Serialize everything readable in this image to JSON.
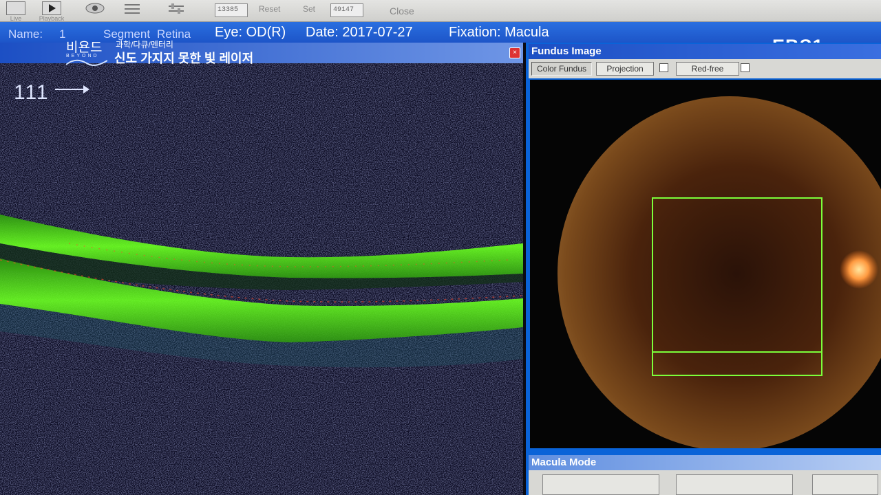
{
  "toolbar": {
    "live_label": "Live",
    "playback_label": "Playback",
    "frame_value": "13385",
    "reset_label": "Reset",
    "set_label": "Set",
    "set_value": "49147",
    "close_label": "Close"
  },
  "infobar": {
    "name_label": "Name:",
    "name_value": "1",
    "segment_value": "Segment",
    "retina_label": "Retina",
    "eye": "Eye: OD(R)",
    "date": "Date: 2017-07-27",
    "fixation": "Fixation: Macula"
  },
  "overlay": {
    "brand": "비욘드",
    "brand_sub": "BEYOND",
    "tags": "과학/다큐/멘터리",
    "main_caption": "신도 가지지 못한 빛 레이저",
    "channel_logo": "EBS1"
  },
  "oct_panel": {
    "scan_number": "111"
  },
  "fundus_panel": {
    "title": "Fundus Image",
    "buttons": [
      "Color Fundus",
      "Projection",
      "Red-free"
    ]
  },
  "macula_panel": {
    "title": "Macula Mode"
  },
  "colors": {
    "info_bar": "#1d55c8",
    "oct_signal": "#5ee61a",
    "fundus_tint": "#5a2e12",
    "scan_box": "#7cff3a"
  },
  "icons": [
    "live-icon",
    "playback-icon",
    "eye-icon",
    "settings-icon",
    "close-icon",
    "arrow-right-icon"
  ]
}
